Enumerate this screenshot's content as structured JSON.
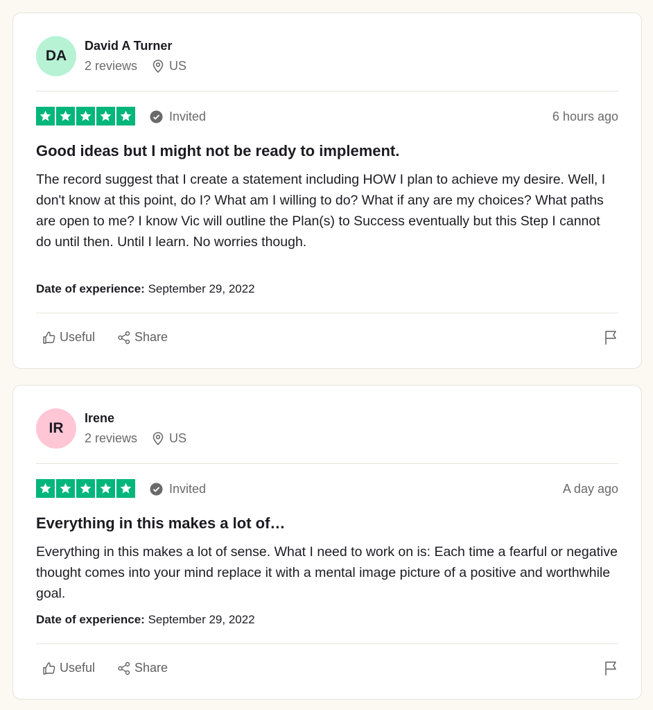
{
  "colors": {
    "page_bg": "#fbf9f1",
    "star_green": "#00b67a",
    "avatar_da": "#b7f2d5",
    "avatar_ir": "#ffc6d6"
  },
  "reviews": [
    {
      "initials": "DA",
      "name": "David A Turner",
      "review_count": "2 reviews",
      "country": "US",
      "rating": 5,
      "invited_label": "Invited",
      "time": "6 hours ago",
      "title": "Good ideas but I might not be ready to implement.",
      "body": "The record suggest that I create a statement including HOW I plan to achieve my desire. Well, I don't know at this point, do I? What am I willing to do? What if any are my choices? What paths are open to me? I know Vic will outline the Plan(s) to Success eventually but this Step I cannot do until then. Until I learn. No worries though.",
      "date_label": "Date of experience:",
      "date": "September 29, 2022",
      "useful_label": "Useful",
      "share_label": "Share"
    },
    {
      "initials": "IR",
      "name": "Irene",
      "review_count": "2 reviews",
      "country": "US",
      "rating": 5,
      "invited_label": "Invited",
      "time": "A day ago",
      "title": "Everything in this makes a lot of…",
      "body": "Everything in this makes a lot of sense. What I need to work on is: Each time a fearful or negative thought comes into your mind replace it with a mental image picture of a positive and worthwhile goal.",
      "date_label": "Date of experience:",
      "date": "September 29, 2022",
      "useful_label": "Useful",
      "share_label": "Share"
    }
  ]
}
